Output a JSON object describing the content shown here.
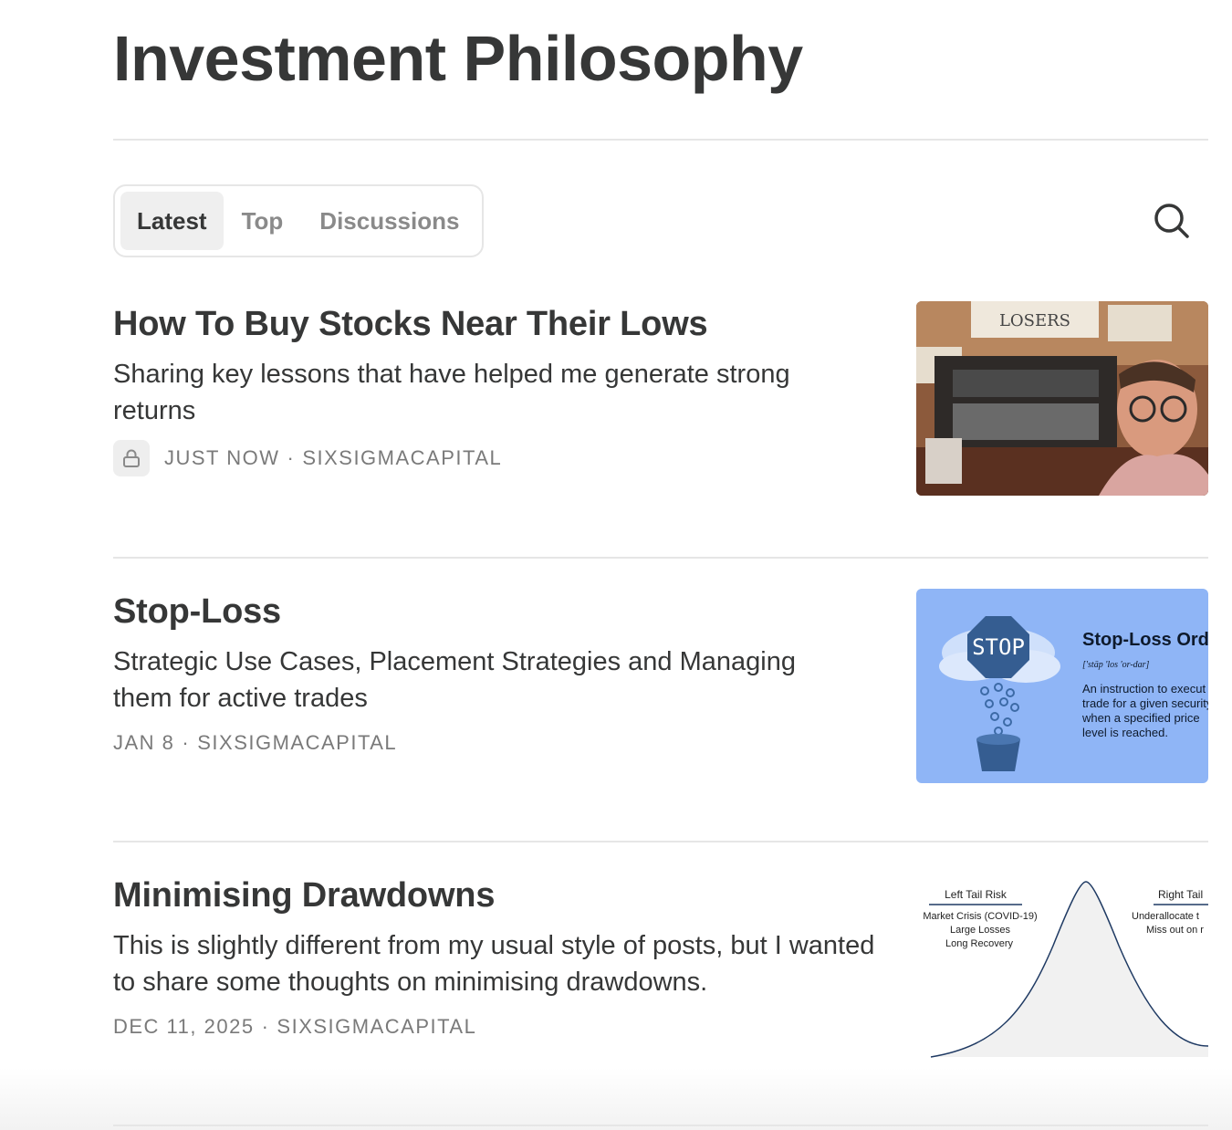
{
  "page": {
    "title": "Investment Philosophy"
  },
  "tabs": [
    {
      "label": "Latest",
      "active": true
    },
    {
      "label": "Top",
      "active": false
    },
    {
      "label": "Discussions",
      "active": false
    }
  ],
  "search": {
    "icon": "search-icon"
  },
  "posts": [
    {
      "title": "How To Buy Stocks Near Their Lows",
      "subtitle": "Sharing key lessons that have helped me generate strong returns",
      "date": "JUST NOW",
      "author": "SIXSIGMACAPITAL",
      "locked": true,
      "thumbnail": {
        "sign_text": "LOSERS"
      }
    },
    {
      "title": "Stop-Loss",
      "subtitle": "Strategic Use Cases, Placement Strategies and Managing them for active trades",
      "date": "JAN 8",
      "author": "SIXSIGMACAPITAL",
      "locked": false,
      "thumbnail": {
        "sign": "STOP",
        "heading": "Stop-Loss Orde",
        "pronunciation": "['stäp 'los 'or-dar]",
        "definition": [
          "An instruction to execut",
          "trade for a given security",
          "when a specified price",
          "level is reached."
        ]
      }
    },
    {
      "title": "Minimising Drawdowns",
      "subtitle": "This is slightly different from my usual style of posts, but I wanted to share some thoughts on minimising drawdowns.",
      "date": "DEC 11, 2025",
      "author": "SIXSIGMACAPITAL",
      "locked": false,
      "thumbnail": {
        "left_title": "Left Tail Risk",
        "left_lines": [
          "Market Crisis (COVID-19)",
          "Large Losses",
          "Long Recovery"
        ],
        "right_title": "Right Tail",
        "right_lines": [
          "Underallocate t",
          "Miss out on r"
        ]
      }
    }
  ],
  "separator": "·",
  "colors": {
    "text": "#363737",
    "meta": "#7a7a7a",
    "divider": "#e6e6e6",
    "tab_active_bg": "#efefef",
    "stop_bg": "#8fb5f6"
  }
}
